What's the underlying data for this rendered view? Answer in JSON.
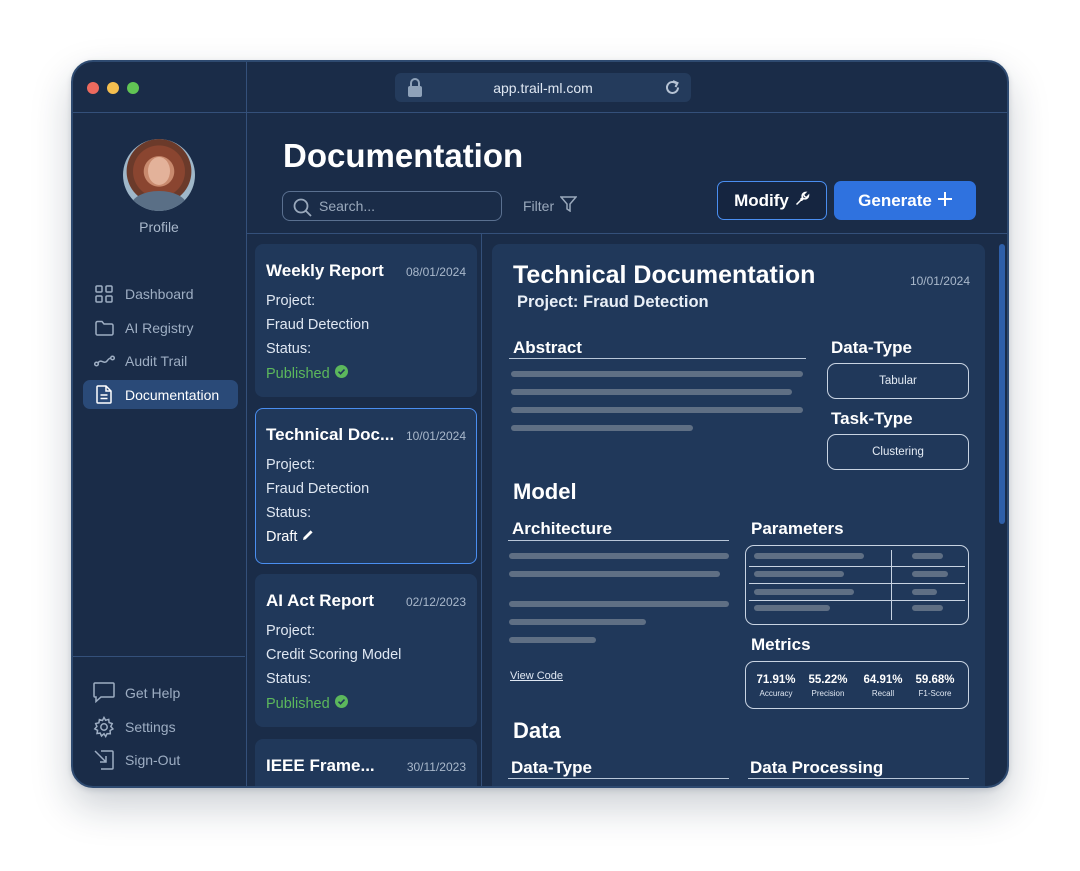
{
  "browser": {
    "url": "app.trail-ml.com"
  },
  "sidebar": {
    "profile_label": "Profile",
    "items": [
      {
        "label": "Dashboard",
        "icon": "grid-icon"
      },
      {
        "label": "AI Registry",
        "icon": "folder-icon"
      },
      {
        "label": "Audit Trail",
        "icon": "trail-icon"
      },
      {
        "label": "Documentation",
        "icon": "document-icon",
        "active": true
      }
    ],
    "bottom_items": [
      {
        "label": "Get Help",
        "icon": "chat-icon"
      },
      {
        "label": "Settings",
        "icon": "gear-icon"
      },
      {
        "label": "Sign-Out",
        "icon": "sign-out-icon"
      }
    ]
  },
  "header": {
    "title": "Documentation",
    "search_placeholder": "Search...",
    "filter_label": "Filter",
    "modify_label": "Modify",
    "generate_label": "Generate"
  },
  "cards": [
    {
      "title": "Weekly Report",
      "date": "08/01/2024",
      "project_label": "Project:",
      "project": "Fraud Detection",
      "status_label": "Status:",
      "status": "Published"
    },
    {
      "title": "Technical Doc...",
      "date": "10/01/2024",
      "project_label": "Project:",
      "project": "Fraud Detection",
      "status_label": "Status:",
      "status": "Draft"
    },
    {
      "title": "AI Act Report",
      "date": "02/12/2023",
      "project_label": "Project:",
      "project": "Credit Scoring Model",
      "status_label": "Status:",
      "status": "Published"
    },
    {
      "title": "IEEE Frame...",
      "date": "30/11/2023"
    }
  ],
  "document": {
    "title": "Technical Documentation",
    "date": "10/01/2024",
    "subtitle": "Project: Fraud Detection",
    "abstract_heading": "Abstract",
    "data_type_heading": "Data-Type",
    "data_type_value": "Tabular",
    "task_type_heading": "Task-Type",
    "task_type_value": "Clustering",
    "model_heading": "Model",
    "architecture_heading": "Architecture",
    "parameters_heading": "Parameters",
    "metrics_heading": "Metrics",
    "view_code_label": "View Code",
    "metrics": [
      {
        "value": "71.91%",
        "label": "Accuracy"
      },
      {
        "value": "55.22%",
        "label": "Precision"
      },
      {
        "value": "64.91%",
        "label": "Recall"
      },
      {
        "value": "59.68%",
        "label": "F1-Score"
      }
    ],
    "data_heading": "Data",
    "data_type_sub_heading": "Data-Type",
    "data_processing_heading": "Data Processing"
  },
  "colors": {
    "accent": "#2f72df",
    "published": "#5cb85c",
    "background": "#1a2c48"
  }
}
